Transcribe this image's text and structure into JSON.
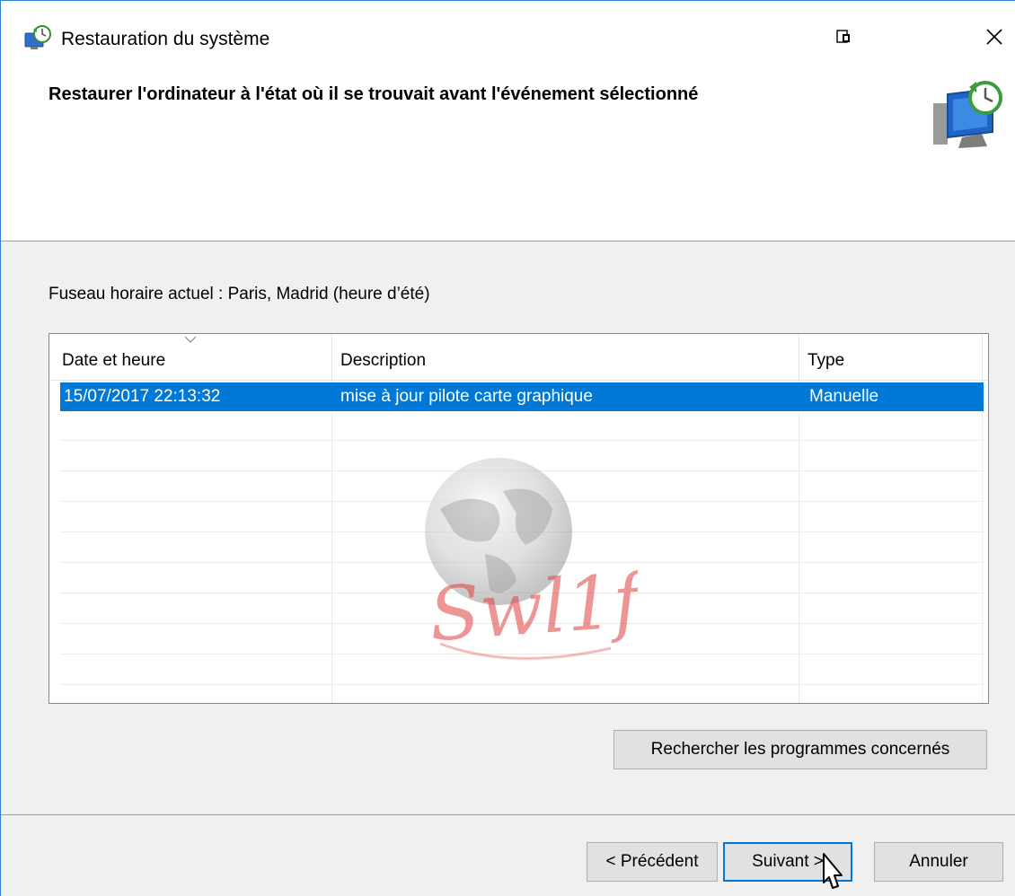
{
  "window": {
    "title": "Restauration du système"
  },
  "header": {
    "title": "Restaurer l'ordinateur à l'état où il se trouvait avant l'événement sélectionné"
  },
  "timezone_label": "Fuseau horaire actuel : Paris, Madrid (heure d’été)",
  "table": {
    "columns": [
      "Date et heure",
      "Description",
      "Type"
    ],
    "rows": [
      {
        "date": "15/07/2017 22:13:32",
        "description": "mise à jour pilote carte graphique",
        "type": "Manuelle",
        "selected": true
      }
    ]
  },
  "buttons": {
    "scan": "Rechercher les programmes concernés",
    "previous": "< Précédent",
    "next": "Suivant >",
    "cancel": "Annuler"
  },
  "watermark_text": "Swl1f",
  "colors": {
    "selection": "#0078d7",
    "focus_border": "#0078d7",
    "watermark_red": "#e04040"
  },
  "icons": {
    "app": "system-restore-icon",
    "header": "system-restore-monitor-icon",
    "restore_window": "tablet-mode-icon",
    "close": "close-icon",
    "sort": "chevron-down-icon"
  }
}
